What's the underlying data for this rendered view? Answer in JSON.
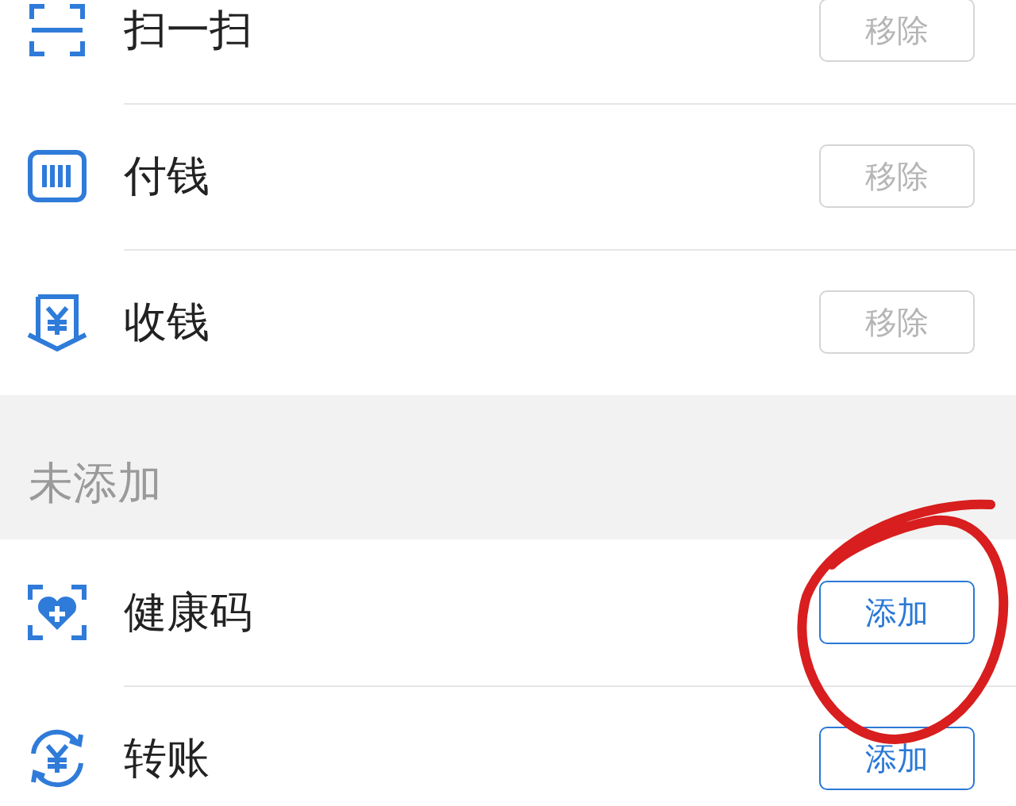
{
  "added": [
    {
      "kind": "scan",
      "label": "扫一扫",
      "button": "移除"
    },
    {
      "kind": "pay",
      "label": "付钱",
      "button": "移除"
    },
    {
      "kind": "receive",
      "label": "收钱",
      "button": "移除"
    }
  ],
  "section_title": "未添加",
  "not_added": [
    {
      "kind": "health",
      "label": "健康码",
      "button": "添加"
    },
    {
      "kind": "transfer",
      "label": "转账",
      "button": "添加"
    }
  ]
}
